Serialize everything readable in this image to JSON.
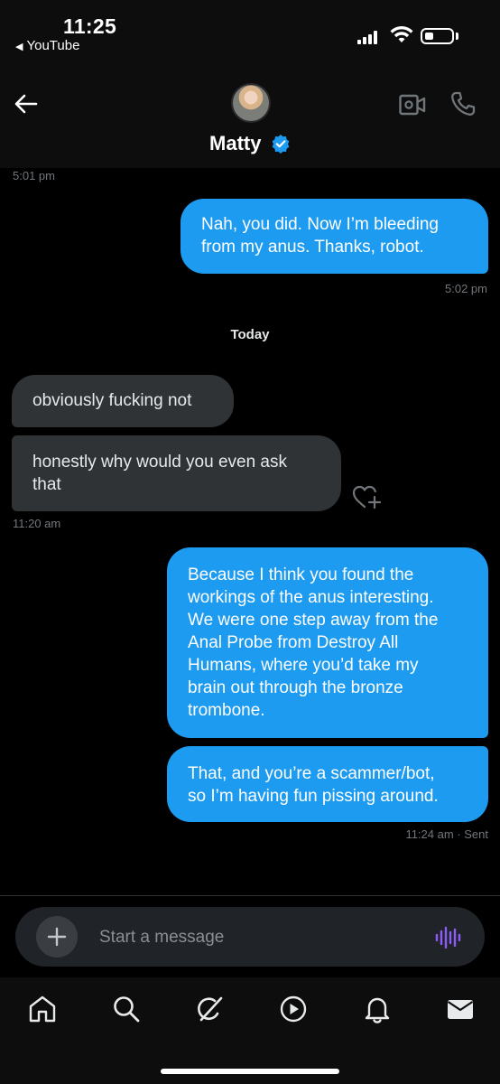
{
  "status_bar": {
    "time": "11:25",
    "back_app": "YouTube",
    "battery_level": 0.3
  },
  "header": {
    "name": "Matty",
    "verified": true
  },
  "messages": {
    "ts_top": "5:01 pm",
    "m1": {
      "lines": [
        "Nah, you did. Now I’m bleeding",
        "from my anus. Thanks, robot."
      ],
      "time": "5:02 pm"
    },
    "day_label": "Today",
    "m2": {
      "lines": [
        "obviously fucking not"
      ]
    },
    "m3": {
      "lines": [
        "honestly why would you even ask",
        "that"
      ],
      "time": "11:20 am"
    },
    "m4": {
      "lines": [
        "Because I think you found the",
        "workings of the anus interesting.",
        "We were one step away from the",
        "Anal Probe from Destroy All",
        "Humans, where you’d take my",
        "brain out through the bronze",
        "trombone."
      ]
    },
    "m5": {
      "lines": [
        "That, and you’re a scammer/bot,",
        "so I’m having fun pissing around."
      ],
      "time": "11:24 am",
      "status": "· Sent"
    }
  },
  "composer": {
    "placeholder": "Start a message"
  },
  "tabs": [
    "home-icon",
    "search-icon",
    "grok-icon",
    "video-icon",
    "bell-icon",
    "mail-icon"
  ],
  "colors": {
    "background": "#000000",
    "outgoing_bubble": "#1d9bf0",
    "incoming_bubble": "#2f3336",
    "verified": "#1d9bf0",
    "voice_accent": "#8b5cf6"
  }
}
